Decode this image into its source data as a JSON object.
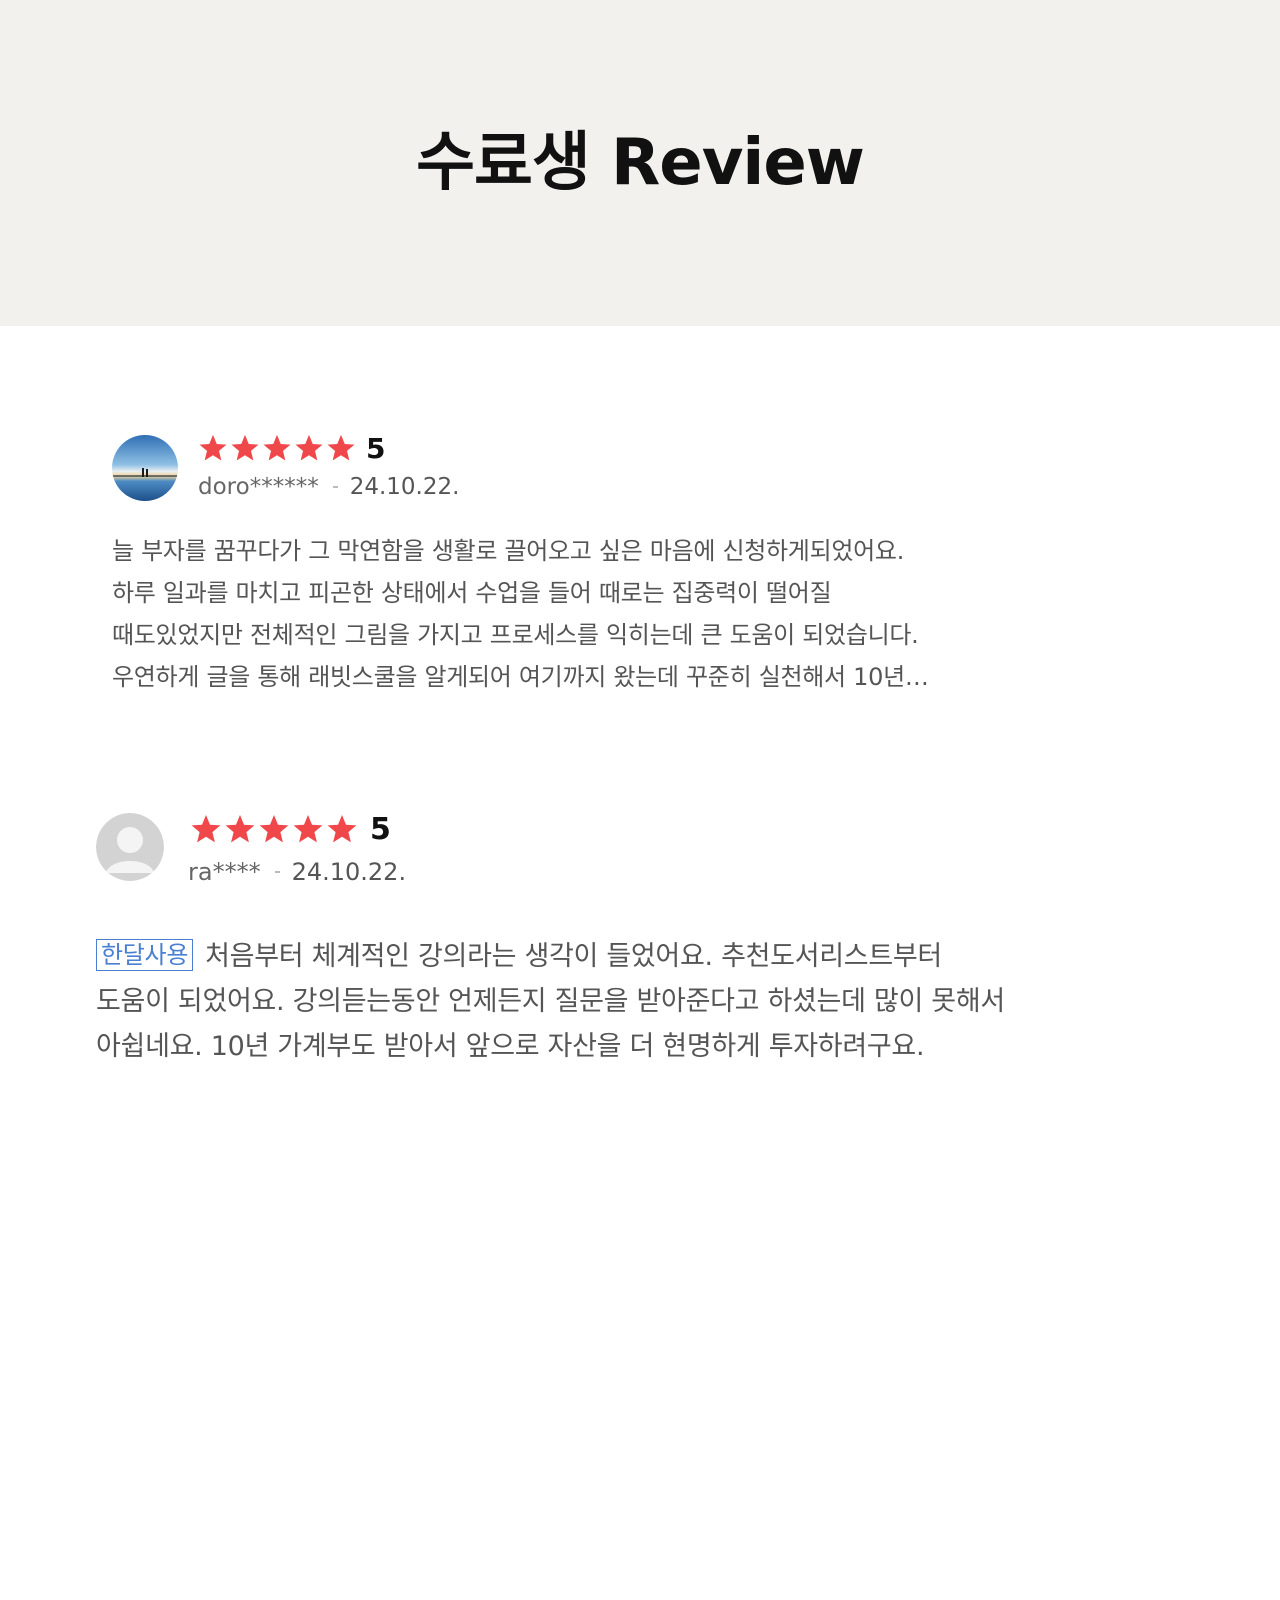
{
  "header": {
    "title": "수료생 Review",
    "background_color": "#f2f1ee"
  },
  "colors": {
    "star": "#f0474b",
    "badge": "#4a7fd1",
    "body_text": "#555555"
  },
  "reviews": [
    {
      "avatar_icon": "sunset-landscape-avatar",
      "stars": 5,
      "rating": "5",
      "username": "doro******",
      "date": "24.10.22.",
      "lines": [
        "늘 부자를 꿈꾸다가 그 막연함을 생활로 끌어오고 싶은 마음에 신청하게되었어요.",
        "하루 일과를 마치고 피곤한 상태에서 수업을 들어 때로는 집중력이 떨어질",
        "때도있었지만 전체적인 그림을 가지고 프로세스를 익히는데 큰 도움이 되었습니다.",
        "우연하게 글을 통해 래빗스쿨을 알게되어 여기까지 왔는데 꾸준히 실천해서 10년…"
      ]
    },
    {
      "avatar_icon": "default-user-avatar",
      "stars": 5,
      "rating": "5",
      "username": "ra****",
      "date": "24.10.22.",
      "badge": "한달사용",
      "lines": [
        "처음부터 체계적인 강의라는 생각이 들었어요. 추천도서리스트부터",
        "도움이 되었어요. 강의듣는동안 언제든지 질문을 받아준다고 하셨는데 많이 못해서",
        "아쉽네요. 10년 가계부도 받아서 앞으로 자산을 더 현명하게 투자하려구요."
      ]
    }
  ]
}
